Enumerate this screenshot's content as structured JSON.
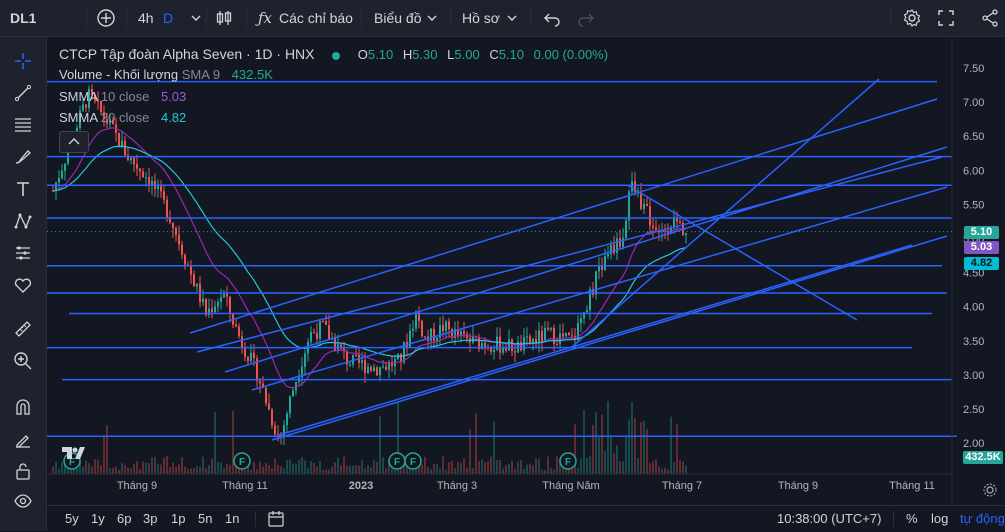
{
  "topbar": {
    "symbol": "DL1",
    "interval": "4h",
    "interval_alt": "D",
    "indicators_label": "Các chỉ báo",
    "chart_menu_label": "Biểu đồ",
    "profile_menu_label": "Hồ sơ"
  },
  "legend": {
    "title": "CTCP Tập đoàn Alpha Seven · 1D · HNX",
    "o_label": "O",
    "o_value": "5.10",
    "h_label": "H",
    "h_value": "5.30",
    "l_label": "L",
    "l_value": "5.00",
    "c_label": "C",
    "c_value": "5.10",
    "change": "0.00 (0.00%)",
    "volume_label": "Volume - Khối lượng",
    "volume_sma": "SMA 9",
    "volume_value": "432.5K",
    "smma10_label": "SMMA",
    "smma10_period": "10 close",
    "smma10_value": "5.03",
    "smma20_label": "SMMA",
    "smma20_period": "20 close",
    "smma20_value": "4.82"
  },
  "price_axis": {
    "ticks": [
      "7.50",
      "7.00",
      "6.50",
      "6.00",
      "5.50",
      "5.00",
      "4.50",
      "4.00",
      "3.50",
      "3.00",
      "2.50",
      "2.00"
    ],
    "last_price": "5.10",
    "smma10_tag": "5.03",
    "smma20_tag": "4.82",
    "volume_tag": "432.5K"
  },
  "time_axis": {
    "ticks": [
      "Tháng 9",
      "Tháng 11",
      "2023",
      "Tháng 3",
      "Tháng Năm",
      "Tháng 7",
      "Tháng 9",
      "Tháng 11"
    ]
  },
  "bottombar": {
    "ranges": [
      "5y",
      "1y",
      "6p",
      "3p",
      "1p",
      "5n",
      "1n"
    ],
    "clock": "10:38:00 (UTC+7)",
    "percent_label": "%",
    "log_label": "log",
    "auto_label": "tự động"
  },
  "colors": {
    "background": "#131722",
    "panel": "#1e222d",
    "up": "#26a69a",
    "down": "#ef5350",
    "drawing": "#2962ff",
    "smma10": "#9c27b0",
    "smma20": "#26c6da",
    "last_price_bg": "#26a69a",
    "smma10_bg": "#7e57c2",
    "smma20_bg": "#00bcd4"
  },
  "events": [
    "F",
    "F",
    "F",
    "F",
    "F"
  ]
}
